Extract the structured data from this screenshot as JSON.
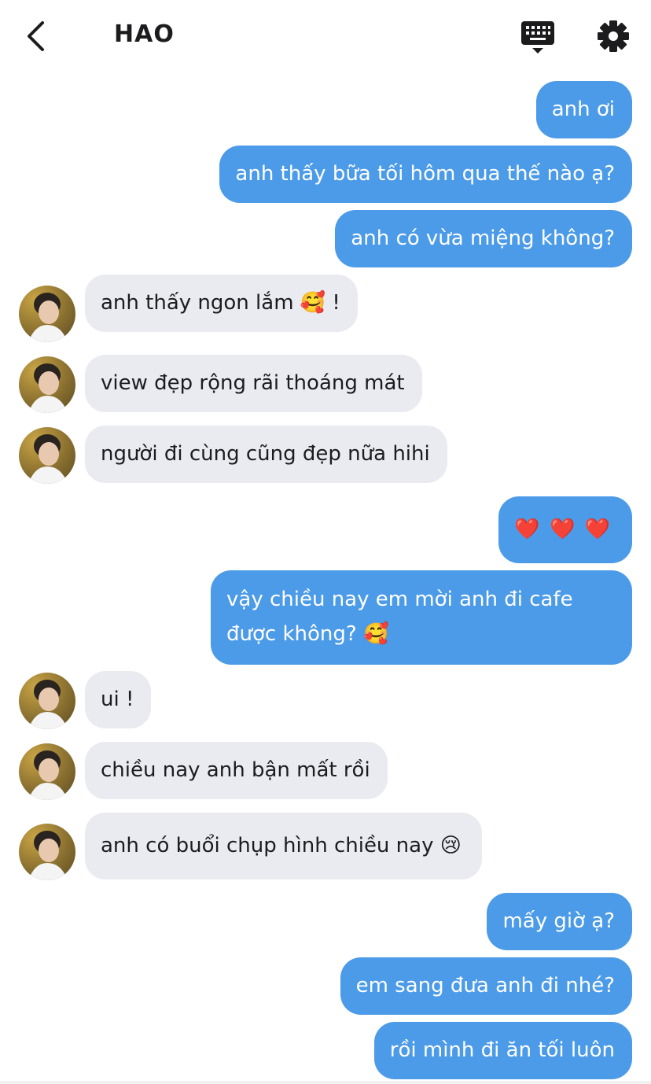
{
  "header": {
    "title": "HAO",
    "back_icon": "chevron-left-icon",
    "keyboard_icon": "keyboard-icon",
    "settings_icon": "gear-icon"
  },
  "colors": {
    "outgoing": "#4c9be8",
    "incoming": "#e9ebf0",
    "text_dark": "#1c1c1e"
  },
  "messages": [
    {
      "side": "out",
      "text": "anh ơi"
    },
    {
      "side": "out",
      "text": "anh thấy bữa tối hôm qua thế nào ạ?"
    },
    {
      "side": "out",
      "text": "anh có vừa miệng không?"
    },
    {
      "side": "in",
      "text": "anh thấy ngon lắm 🥰 !"
    },
    {
      "side": "in",
      "text": "view đẹp rộng rãi thoáng mát"
    },
    {
      "side": "in",
      "text": "người đi cùng cũng đẹp nữa hihi"
    },
    {
      "side": "out",
      "text": "❤️ ❤️ ❤️"
    },
    {
      "side": "out",
      "text": "vậy chiều nay em mời anh đi cafe được không? 🥰"
    },
    {
      "side": "in",
      "text": "ui !"
    },
    {
      "side": "in",
      "text": "chiều nay anh bận mất rồi"
    },
    {
      "side": "in",
      "text": "anh có buổi chụp hình chiều nay 😢"
    },
    {
      "side": "out",
      "text": "mấy giờ ạ?"
    },
    {
      "side": "out",
      "text": "em sang đưa anh đi nhé?"
    },
    {
      "side": "out",
      "text": "rồi mình đi ăn tối luôn"
    }
  ]
}
